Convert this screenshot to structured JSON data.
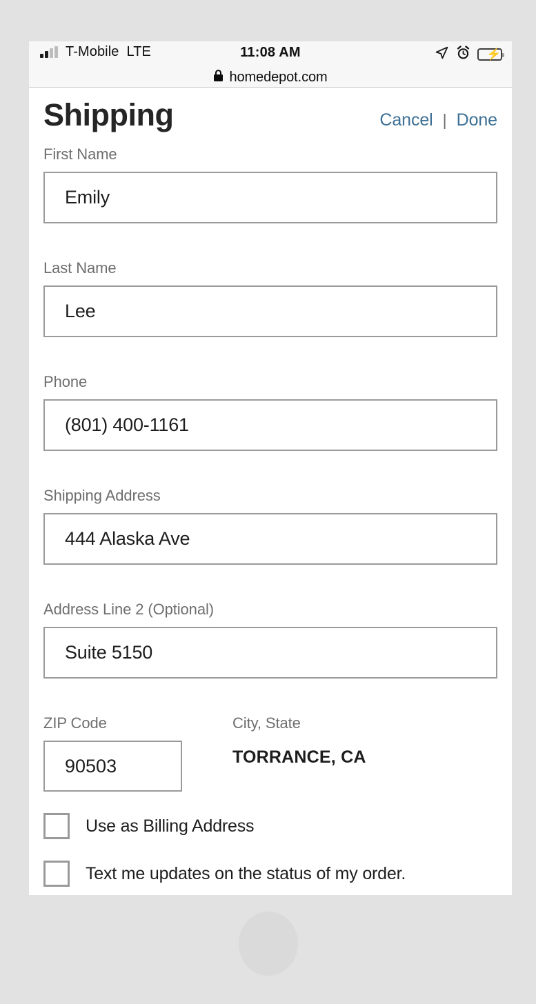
{
  "status_bar": {
    "carrier": "T-Mobile",
    "network": "LTE",
    "time": "11:08 AM",
    "signal_bars_filled": 2,
    "signal_bars_total": 4,
    "icons": [
      "location-arrow-icon",
      "alarm-clock-icon",
      "battery-charging-icon"
    ],
    "battery_percent": 62,
    "battery_color": "#36c94a"
  },
  "browser": {
    "url": "homedepot.com",
    "lock_icon": "lock-icon"
  },
  "header": {
    "title": "Shipping",
    "cancel_label": "Cancel",
    "divider": "|",
    "done_label": "Done",
    "link_color": "#3d7094"
  },
  "form": {
    "fields": [
      {
        "label": "First Name",
        "value": "Emily",
        "placeholder": "First Name"
      },
      {
        "label": "Last Name",
        "value": "Lee",
        "placeholder": "Last Name"
      },
      {
        "label": "Phone",
        "value": "(801) 400-1161",
        "placeholder": "Phone"
      },
      {
        "label": "Shipping Address",
        "value": "444 Alaska Ave",
        "placeholder": "Shipping Address"
      },
      {
        "label": "Address Line 2 (Optional)",
        "value": "Suite 5150",
        "placeholder": "Address Line 2"
      }
    ],
    "zip": {
      "label": "ZIP Code",
      "value": "90503",
      "placeholder": "ZIP Code"
    },
    "city_state": {
      "label": "City, State",
      "value": "TORRANCE, CA"
    },
    "checkboxes": [
      {
        "label": "Use as Billing Address",
        "checked": false
      },
      {
        "label": "Text me updates on the status of my order.",
        "checked": false
      }
    ]
  }
}
